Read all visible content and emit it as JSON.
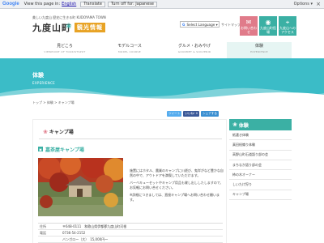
{
  "translate_bar": {
    "brand": "Google",
    "view_text": "View this page in:",
    "language": "English",
    "translate_button": "Translate",
    "turn_off": "Turn off for: Japanese",
    "options": "Options ▾",
    "close": "×"
  },
  "header": {
    "tagline": "美しい九度山 歴史に生きる町 KUDOYAMA TOWN",
    "title": "九度山町",
    "mark": "❀",
    "subtitle": "観光情報",
    "language_select": "Select Language ▾",
    "sitemap": "サイトマップ",
    "buttons": [
      {
        "icon": "✉",
        "label": "お問い合わせ"
      },
      {
        "icon": "◉",
        "label": "九度山町役場"
      },
      {
        "icon": "⌖",
        "label": "九度山へのアクセス"
      }
    ]
  },
  "nav": [
    {
      "label": "見どころ",
      "en": "VIEWPOINT OF TOURISTSPOT"
    },
    {
      "label": "モデルコース",
      "en": "MODEL COURSE"
    },
    {
      "label": "グルメ・おみやげ",
      "en": "GOURMET & SOUVENIR"
    },
    {
      "label": "体験",
      "en": "EXPERIENCE"
    }
  ],
  "hero": {
    "title": "体験",
    "en": "EXPERIENCE"
  },
  "breadcrumb": "トップ > 体験 > キャンプ場",
  "social": {
    "tweet": "ツイート",
    "like": "いいね! 0",
    "share": "シェアする"
  },
  "main": {
    "heading": "キャンプ場",
    "section_title": "嘉茶屋キャンプ場",
    "section_icon": "▣",
    "description": [
      "施置にはホタル、農業のキャンプに川遊び、鬼岸がなど豊かな自然の中で、アウトドアを満喫していただけます。",
      "バーベキューセットやキャンプ用品も貸し出ししたしますので、お気軽にお問い合せください。",
      "※詳細につきましては、直接キャンプ場へお問い合わせ願います。"
    ],
    "info": [
      {
        "key": "住所",
        "value": "〒648-0111　和歌山県伊都郡九度山町河根"
      },
      {
        "key": "電話",
        "value": "0736-54-2152"
      },
      {
        "key": "",
        "value": "バンガロー（大）　15,000円〜"
      }
    ]
  },
  "sidebar": {
    "heading": "体験",
    "items": [
      "紙漉き体験",
      "真田紐織り体験",
      "高野山町石道語り部の会",
      "まちなか語り部の会",
      "柿の木オーナー",
      "しいたけ狩り",
      "キャンプ場"
    ]
  },
  "colors": {
    "accent": "#3bb0a4",
    "hero": "#3bbcc7",
    "brand_orange": "#e8a325",
    "flower": "#e07b8a"
  }
}
